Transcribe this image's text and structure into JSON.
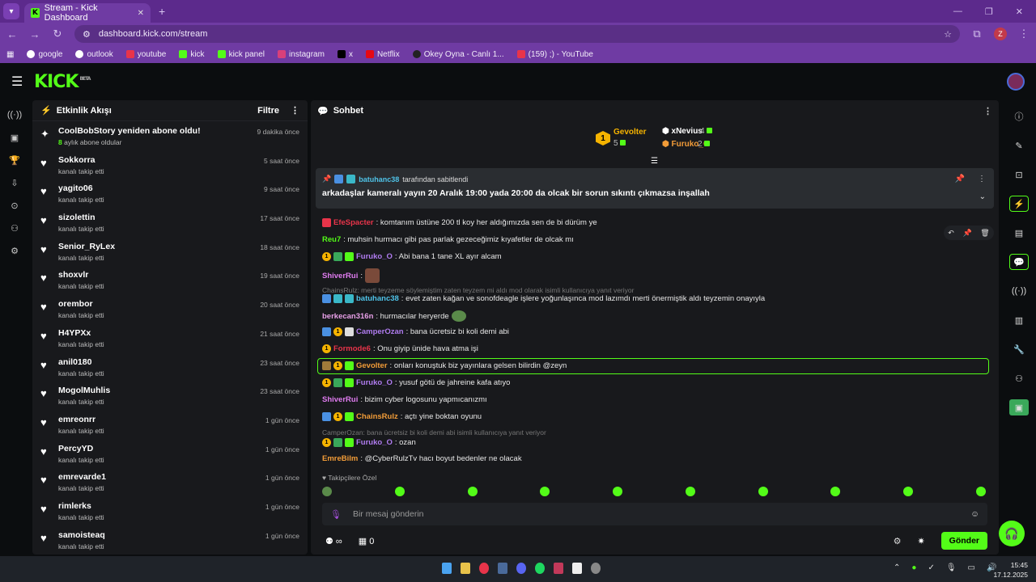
{
  "browser": {
    "tab_title": "Stream - Kick Dashboard",
    "url": "dashboard.kick.com/stream",
    "profile_initial": "Z",
    "bookmarks": [
      "google",
      "outlook",
      "youtube",
      "kick",
      "kick panel",
      "instagram",
      "x",
      "Netflix",
      "Okey Oyna - Canlı 1...",
      "(159) ;) - YouTube"
    ]
  },
  "kick": {
    "logo": "KICK",
    "beta": "BETA"
  },
  "activity": {
    "title": "Etkinlik Akışı",
    "filter": "Filtre",
    "items": [
      {
        "name": "CoolBobStory yeniden abone oldu!",
        "sub_count": "8",
        "sub": " aylık abone oldular",
        "time": "9 dakika önce",
        "type": "sub"
      },
      {
        "name": "Sokkorra",
        "sub": "kanalı takip etti",
        "time": "5 saat önce"
      },
      {
        "name": "yagito06",
        "sub": "kanalı takip etti",
        "time": "9 saat önce"
      },
      {
        "name": "sizolettin",
        "sub": "kanalı takip etti",
        "time": "17 saat önce"
      },
      {
        "name": "Senior_RyLex",
        "sub": "kanalı takip etti",
        "time": "18 saat önce"
      },
      {
        "name": "shoxvlr",
        "sub": "kanalı takip etti",
        "time": "19 saat önce"
      },
      {
        "name": "orembor",
        "sub": "kanalı takip etti",
        "time": "20 saat önce"
      },
      {
        "name": "H4YPXx",
        "sub": "kanalı takip etti",
        "time": "21 saat önce"
      },
      {
        "name": "anil0180",
        "sub": "kanalı takip etti",
        "time": "23 saat önce"
      },
      {
        "name": "MogolMuhlis",
        "sub": "kanalı takip etti",
        "time": "23 saat önce"
      },
      {
        "name": "emreonrr",
        "sub": "kanalı takip etti",
        "time": "1 gün önce"
      },
      {
        "name": "PercyYD",
        "sub": "kanalı takip etti",
        "time": "1 gün önce"
      },
      {
        "name": "emrevarde1",
        "sub": "kanalı takip etti",
        "time": "1 gün önce"
      },
      {
        "name": "rimlerks",
        "sub": "kanalı takip etti",
        "time": "1 gün önce"
      },
      {
        "name": "samoisteaq",
        "sub": "kanalı takip etti",
        "time": "1 gün önce"
      }
    ]
  },
  "chat": {
    "title": "Sohbet",
    "leaderboard": {
      "first": {
        "name": "Gevolter",
        "rank": "1",
        "count": "5"
      },
      "second": {
        "name": "xNevius",
        "count": "4"
      },
      "third": {
        "name": "Furuko_O",
        "count": "2"
      }
    },
    "pinned": {
      "by": "batuhanc38",
      "by_suffix": " tarafından sabitlendi",
      "message": "arkadaşlar kameralı yayın 20 Aralık 19:00 yada 20:00 da olcak bir sorun sıkıntı çıkmazsa inşallah"
    },
    "messages": [
      {
        "user": "EfeSpacter",
        "color": "#e8344a",
        "text": ": komtanım üstüne 200 tl koy her aldığımızda sen de bi dürüm ye"
      },
      {
        "user": "Reu7",
        "color": "#53fc18",
        "text": ": muhsin hurmacı gibi pas parlak gezeceğimiz kıyafetler de olcak mı"
      },
      {
        "user": "Furuko_O",
        "color": "#b07cf0",
        "text": ": Abi bana 1 tane XL ayır alcam"
      },
      {
        "user": "ShiverRui",
        "color": "#e07cf0",
        "text": ":"
      },
      {
        "reply": "ChainsRulz: merti teyzeme söylemiştim zaten teyzem mi aldı mod olarak isimli kullanıcıya yanıt veriyor"
      },
      {
        "user": "batuhanc38",
        "color": "#4fc3e8",
        "text": ": evet zaten kağan ve sonofdeagle işlere yoğunlaşınca mod lazımdı merti önermiştik aldı teyzemin onayıyla"
      },
      {
        "user": "berkecan316n",
        "color": "#e8a0e8",
        "text": ": hurmacılar heryerde"
      },
      {
        "user": "CamperOzan",
        "color": "#b07cf0",
        "text": ": bana ücretsiz bi koli demi abi"
      },
      {
        "user": "Formode6",
        "color": "#e8344a",
        "text": ": Onu giyip ünide hava atma işi"
      },
      {
        "user": "Gevolter",
        "color": "#f29c38",
        "text": ": onları konuştuk biz yayınlara gelsen bilirdin @zeyn"
      },
      {
        "user": "Furuko_O",
        "color": "#b07cf0",
        "text": ": yusuf götü de jahreine kafa atıyo"
      },
      {
        "user": "ShiverRui",
        "color": "#e07cf0",
        "text": ": bizim cyber logosunu yapmıcanızmı"
      },
      {
        "user": "ChainsRulz",
        "color": "#f29c38",
        "text": ": açtı yine boktan oyunu"
      },
      {
        "reply": "CamperOzan: bana ücretsiz bi koli demi abi isimli kullanıcıya yanıt veriyor"
      },
      {
        "user": "Furuko_O",
        "color": "#b07cf0",
        "text": ": ozan"
      },
      {
        "user": "EmreBilm",
        "color": "#f29c38",
        "text": ": @CyberRulzTv hacı boyut bedenler ne olacak"
      }
    ],
    "followers_only": "Takipçilere Özel",
    "input_placeholder": "Bir mesaj gönderin",
    "points": "∞",
    "count": "0",
    "send": "Gönder"
  },
  "taskbar": {
    "time": "15:45",
    "date": "17.12.2025"
  }
}
